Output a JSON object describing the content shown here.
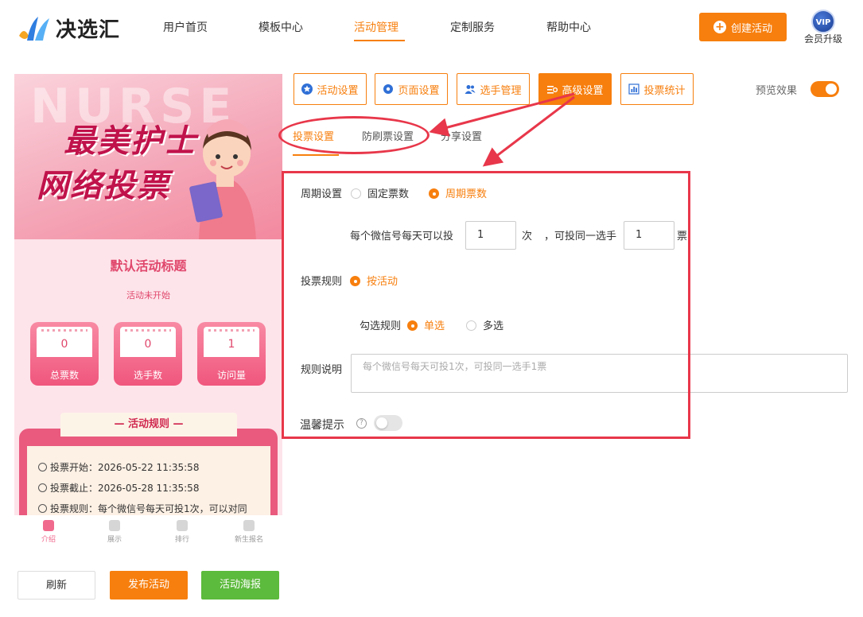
{
  "brand": {
    "name": "决选汇"
  },
  "nav": {
    "items": [
      {
        "label": "用户首页"
      },
      {
        "label": "模板中心"
      },
      {
        "label": "活动管理"
      },
      {
        "label": "定制服务"
      },
      {
        "label": "帮助中心"
      }
    ],
    "active": "活动管理",
    "create_button": "创建活动",
    "vip_badge": "VIP",
    "vip_label": "会员升级"
  },
  "preview": {
    "banner_bg_text": "NURSE",
    "banner_line1": "最美护士",
    "banner_line2": "网络投票",
    "activity_title": "默认活动标题",
    "status": "活动未开始",
    "stats": [
      {
        "value": "0",
        "label": "总票数"
      },
      {
        "value": "0",
        "label": "选手数"
      },
      {
        "value": "1",
        "label": "访问量"
      }
    ],
    "rules_heading": "— 活动规则 —",
    "rules": [
      "投票开始：2026-05-22 11:35:58",
      "投票截止：2026-05-28 11:35:58",
      "投票规则：每个微信号每天可投1次，可以对同"
    ],
    "tabbar": [
      {
        "label": "介绍",
        "icon": "nurse-icon"
      },
      {
        "label": "展示",
        "icon": "gift-icon"
      },
      {
        "label": "排行",
        "icon": "heart-pulse-icon"
      },
      {
        "label": "新生报名",
        "icon": "pill-icon"
      }
    ]
  },
  "actions": {
    "refresh": "刷新",
    "publish": "发布活动",
    "poster": "活动海报"
  },
  "toolbar": {
    "buttons": [
      {
        "label": "活动设置",
        "icon": "star-icon"
      },
      {
        "label": "页面设置",
        "icon": "gear-icon"
      },
      {
        "label": "选手管理",
        "icon": "users-icon"
      },
      {
        "label": "高级设置",
        "icon": "settings-sliders-icon"
      },
      {
        "label": "投票统计",
        "icon": "bar-chart-icon"
      }
    ],
    "active": "高级设置",
    "preview_label": "预览效果",
    "preview_on": true
  },
  "subtabs": {
    "items": [
      "投票设置",
      "防刷票设置",
      "分享设置"
    ],
    "active": "投票设置"
  },
  "form": {
    "cycle_label": "周期设置",
    "cycle_options": [
      "固定票数",
      "周期票数"
    ],
    "cycle_selected": "周期票数",
    "per_day_prefix": "每个微信号每天可以投",
    "per_day_value": "1",
    "per_day_unit": "次",
    "same_player_prefix": "，可投同一选手",
    "same_player_value": "1",
    "same_player_unit": "票",
    "rule_label": "投票规则",
    "rule_option": "按活动",
    "check_label": "勾选规则",
    "check_options": [
      "单选",
      "多选"
    ],
    "check_selected": "单选",
    "desc_label": "规则说明",
    "desc_placeholder": "每个微信号每天可投1次，可投同一选手1票",
    "tip_label": "温馨提示",
    "tip_on": false
  },
  "colors": {
    "accent": "#f77f0e",
    "annotation_red": "#e8374a",
    "success_green": "#5cba3c",
    "preview_pink": "#e0476c"
  }
}
